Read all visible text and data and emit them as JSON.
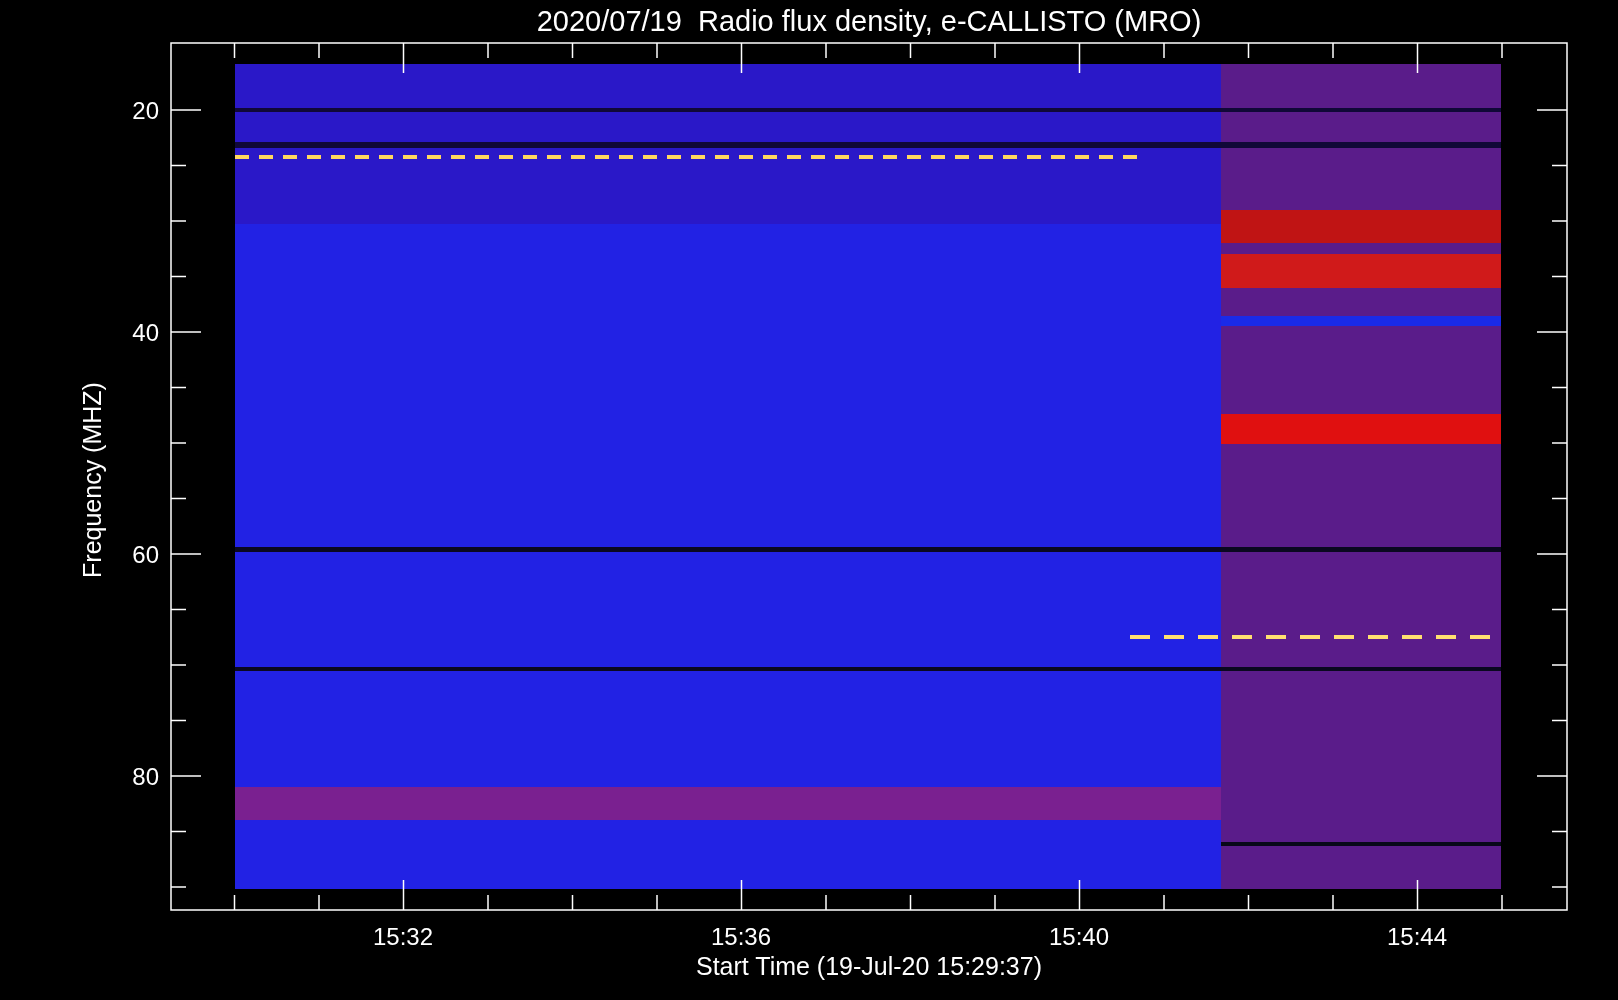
{
  "title": "2020/07/19  Radio flux density, e-CALLISTO (MRO)",
  "y_axis": {
    "label": "Frequency (MHZ)",
    "tick_labels": [
      "20",
      "40",
      "60",
      "80"
    ]
  },
  "x_axis": {
    "label": "Start Time (19-Jul-20 15:29:37)",
    "tick_labels": [
      "15:32",
      "15:36",
      "15:40",
      "15:44"
    ]
  }
}
